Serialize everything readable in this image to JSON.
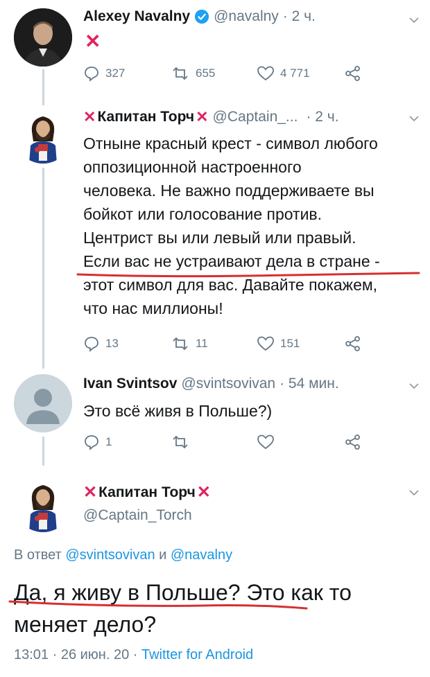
{
  "tweet1": {
    "name": "Alexey Navalny",
    "handle": "@navalny",
    "time": "· 2 ч.",
    "text": "✕",
    "replies": "327",
    "retweets": "655",
    "likes": "4 771"
  },
  "tweet2": {
    "name": "Капитан Торч",
    "handle": "@Captain_...",
    "time": "· 2 ч.",
    "lines": [
      "Отныне красный крест - символ любого",
      "оппозиционной настроенного",
      "человека. Не важно поддерживаете вы",
      "бойкот или голосование против.",
      "Центрист вы или левый или правый.",
      "Если вас не устраивают дела в стране -",
      "этот символ для вас. Давайте покажем,",
      "что нас миллионы!"
    ],
    "replies": "13",
    "retweets": "11",
    "likes": "151"
  },
  "tweet3": {
    "name": "Ivan Svintsov",
    "handle": "@svintsovivan",
    "time": "· 54 мин.",
    "text": "Это всё живя в Польше?)",
    "replies": "1"
  },
  "main": {
    "name": "Капитан Торч",
    "handle": "@Captain_Torch",
    "reply_prefix": "В ответ",
    "reply_user1": "@svintsovivan",
    "reply_and": "и",
    "reply_user2": "@navalny",
    "line1": "Да, я живу в Польше? Это как то",
    "line2": "меняет дело?",
    "meta_time": "13:01 · 26 июн. 20 ·",
    "meta_source": "Twitter for Android"
  },
  "colors": {
    "accent": "#1b95e0",
    "red_cross": "#e0245e",
    "underline": "#d62f2f",
    "verified": "#1da1f2"
  }
}
